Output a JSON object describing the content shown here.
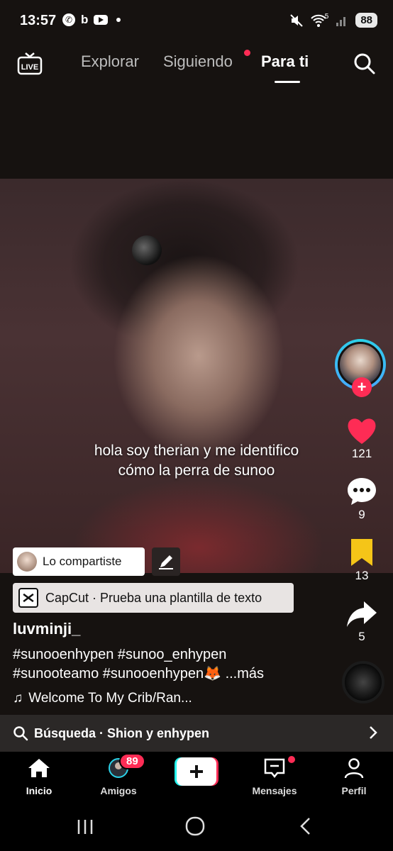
{
  "status_bar": {
    "time": "13:57",
    "battery": "88",
    "network": "5"
  },
  "top_nav": {
    "live_label": "LIVE",
    "tabs": [
      {
        "label": "Explorar"
      },
      {
        "label": "Siguiendo"
      },
      {
        "label": "Para ti"
      }
    ]
  },
  "video": {
    "caption_line1": "hola soy therian y me identifico",
    "caption_line2": "cómo la perra de sunoo"
  },
  "rail": {
    "likes": "121",
    "comments": "9",
    "saves": "13",
    "shares": "5"
  },
  "shared_pill": {
    "label": "Lo compartiste"
  },
  "capcut": {
    "label": "CapCut · Prueba una plantilla de texto"
  },
  "post": {
    "username": "luvminji_",
    "desc_line1": "#sunooenhypen #sunoo_enhypen",
    "desc_line2": "#sunooteamo #sunooenhypen🦊  ...más",
    "music": "Welcome To My Crib/Ran..."
  },
  "search_suggest": {
    "label": "Búsqueda · Shion y enhypen"
  },
  "bottom_nav": {
    "items": [
      {
        "label": "Inicio"
      },
      {
        "label": "Amigos",
        "badge": "89"
      },
      {
        "label": "Mensajes"
      },
      {
        "label": "Perfil"
      }
    ]
  },
  "colors": {
    "accent": "#fe2c55",
    "save": "#f5c518",
    "avatar_ring": "#2bd2e8"
  }
}
